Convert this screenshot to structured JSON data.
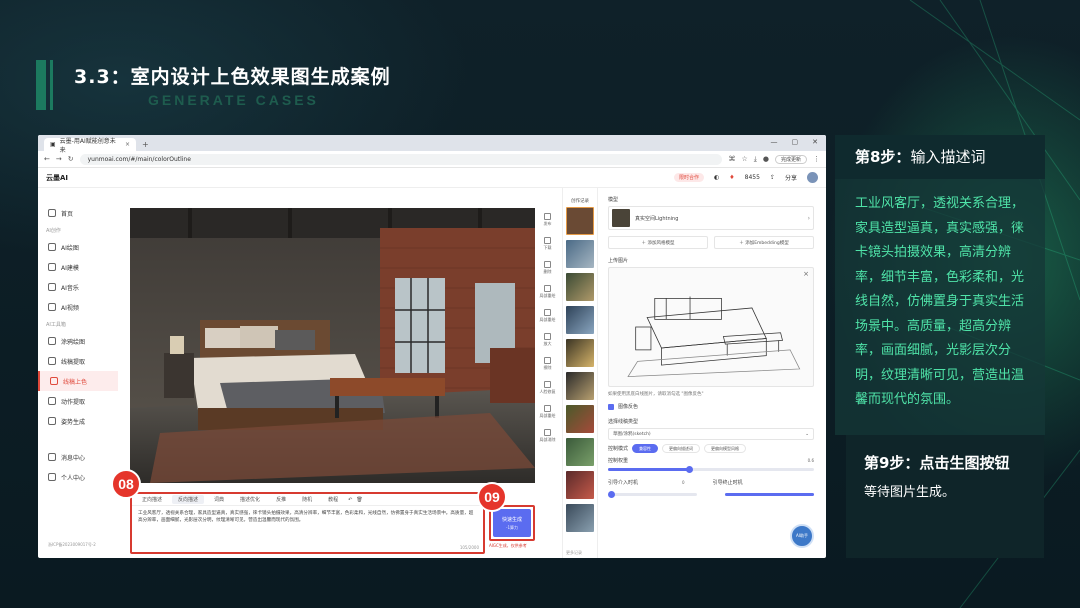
{
  "slide": {
    "title": "3.3：室内设计上色效果图生成案例",
    "subtitle": "GENERATE CASES"
  },
  "browser": {
    "tab_title": "云墨-用AI赋能创意未来",
    "new_tab": "+",
    "url": "yunmoai.com/#/main/colorOutline",
    "update_button": "完成更新"
  },
  "app": {
    "logo": "云墨AI",
    "header": {
      "promo": "限时合作",
      "credits": "8455",
      "share": "分享"
    },
    "sidebar": {
      "items": [
        {
          "label": "首页",
          "icon": "home-icon"
        },
        {
          "section": "AI创作"
        },
        {
          "label": "AI绘图",
          "icon": "image-icon"
        },
        {
          "label": "AI建模",
          "icon": "cube-icon"
        },
        {
          "label": "AI音乐",
          "icon": "music-icon"
        },
        {
          "label": "AI视频",
          "icon": "video-icon"
        },
        {
          "section": "AI工具箱"
        },
        {
          "label": "涂鸦绘图",
          "icon": "brush-icon"
        },
        {
          "label": "线稿提取",
          "icon": "edit-icon"
        },
        {
          "label": "线稿上色",
          "icon": "palette-icon",
          "active": true
        },
        {
          "label": "动作提取",
          "icon": "pose-icon"
        },
        {
          "label": "姿势生成",
          "icon": "figure-icon"
        },
        {
          "label": "消息中心",
          "icon": "bell-icon"
        },
        {
          "label": "个人中心",
          "icon": "user-icon"
        }
      ],
      "footer": "浙ICP备2023009017号-2"
    },
    "tools": [
      "发布",
      "下载",
      "删除",
      "局部重绘",
      "局部重绘",
      "放大",
      "擦除",
      "人脸修复",
      "局部重绘",
      "局部消除"
    ],
    "prompt": {
      "tabs": [
        "正向描述",
        "反向描述",
        "词典",
        "描述优化",
        "反推",
        "随机",
        "教程"
      ],
      "text": "工业风客厅，透视关系合理，家具造型逼真，真实感强，徕卡镜头拍摄效果，高清分辨率，细节丰富，色彩柔和，光线自然，仿佛置身于真实生活场景中。高质量，超高分辨率，画面细腻，光影层次分明，纹理清晰可见，营造出温馨而现代的氛围。",
      "count": "105/2000"
    },
    "generate": {
      "label": "快速生成",
      "cost": "-1算力",
      "note": "AIGC生成，仅供参考"
    },
    "history": {
      "title": "创作记录",
      "more": "更多记录"
    },
    "settings": {
      "model_label": "模型",
      "model_name": "真实空间Lightning",
      "add_lora": "添加风格模型",
      "add_embedding": "添加Embedding模型",
      "upload_label": "上传图片",
      "upload_hint": "如果使用黑底白线图片，请取消勾选 \"图像反色\"",
      "invert_label": "图像反色",
      "line_type_label": "选择线稿类型",
      "line_type_value": "草图/涂鸦(sketch)",
      "control_mode_label": "控制模式",
      "control_modes": [
        "兼容性",
        "更偏向描述词",
        "更偏向模型风格"
      ],
      "control_weight_label": "控制权重",
      "control_weight_value": "0.6",
      "guide_start_label": "引导介入时机",
      "guide_start_value": "0",
      "guide_end_label": "引导终止时机",
      "assistant": "AI助手"
    }
  },
  "badges": {
    "step8": "08",
    "step9": "09"
  },
  "panel_step8": {
    "head_bold": "第8步：",
    "head_rest": "输入描述词",
    "body": "工业风客厅，透视关系合理，家具造型逼真，真实感强，徕卡镜头拍摄效果，高清分辨率，细节丰富，色彩柔和，光线自然，仿佛置身于真实生活场景中。高质量，超高分辨率，画面细腻，光影层次分明，纹理清晰可见，营造出温馨而现代的氛围。"
  },
  "panel_step9": {
    "head": "第9步：点击生图按钮",
    "body": "等待图片生成。"
  }
}
